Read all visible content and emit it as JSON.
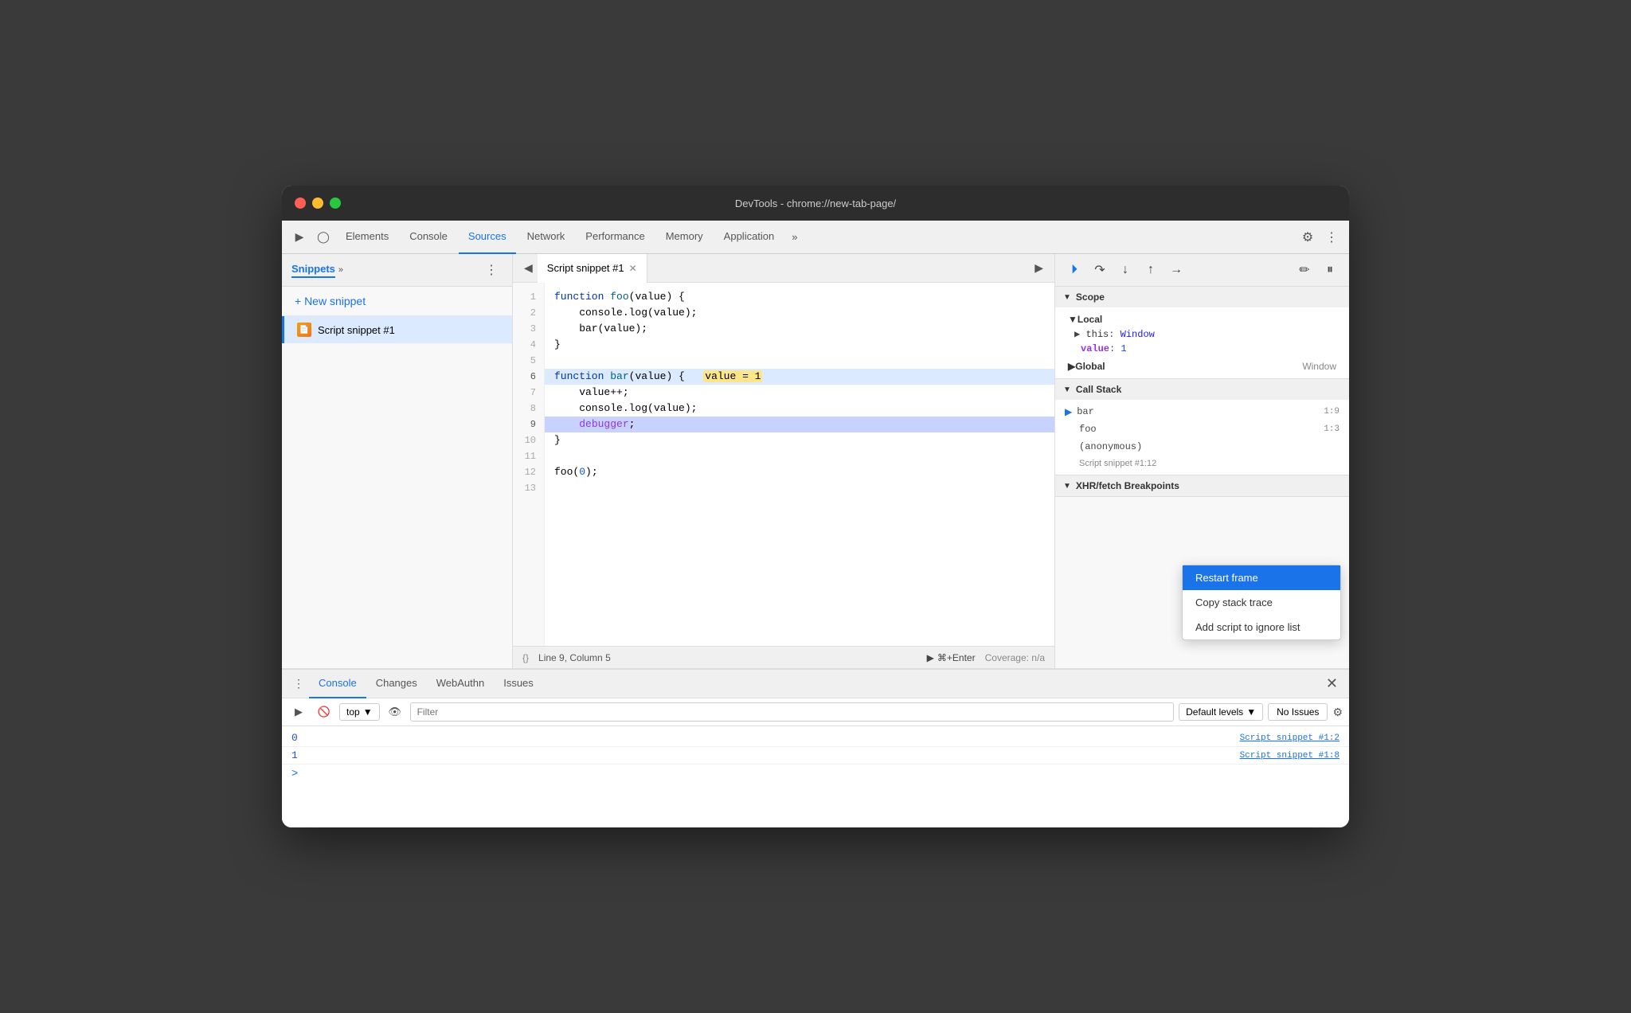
{
  "window": {
    "title": "DevTools - chrome://new-tab-page/"
  },
  "nav": {
    "tabs": [
      {
        "label": "Elements",
        "active": false
      },
      {
        "label": "Console",
        "active": false
      },
      {
        "label": "Sources",
        "active": true
      },
      {
        "label": "Network",
        "active": false
      },
      {
        "label": "Performance",
        "active": false
      },
      {
        "label": "Memory",
        "active": false
      },
      {
        "label": "Application",
        "active": false
      }
    ],
    "more_label": "»",
    "settings_title": "Settings",
    "dots_title": "More options"
  },
  "sidebar": {
    "tab_label": "Snippets",
    "new_snippet_label": "+ New snippet",
    "snippet_name": "Script snippet #1"
  },
  "editor": {
    "tab_name": "Script snippet #1",
    "lines": [
      {
        "num": 1,
        "code": "function foo(value) {"
      },
      {
        "num": 2,
        "code": "    console.log(value);"
      },
      {
        "num": 3,
        "code": "    bar(value);"
      },
      {
        "num": 4,
        "code": "}"
      },
      {
        "num": 5,
        "code": ""
      },
      {
        "num": 6,
        "code": "function bar(value) {   value = 1"
      },
      {
        "num": 7,
        "code": "    value++;"
      },
      {
        "num": 8,
        "code": "    console.log(value);"
      },
      {
        "num": 9,
        "code": "    debugger;",
        "paused": true
      },
      {
        "num": 10,
        "code": "}"
      },
      {
        "num": 11,
        "code": ""
      },
      {
        "num": 12,
        "code": "foo(0);"
      },
      {
        "num": 13,
        "code": ""
      }
    ],
    "status": {
      "format": "{}",
      "location": "Line 9, Column 5",
      "run_label": "⌘+Enter",
      "run_icon": "▶",
      "coverage": "Coverage: n/a"
    }
  },
  "right_panel": {
    "debugger_tools": [
      "resume",
      "step-over",
      "step-into",
      "step-out",
      "step",
      "deactivate",
      "pause"
    ],
    "scope_label": "Scope",
    "local_label": "Local",
    "this_label": "this:",
    "this_val": "Window",
    "value_label": "value:",
    "value_val": "1",
    "global_label": "Global",
    "global_val": "Window",
    "callstack_label": "Call Stack",
    "callstack_items": [
      {
        "name": "bar",
        "loc": "1:9"
      },
      {
        "name": "foo",
        "loc": "1:3"
      },
      {
        "name": "(anonymous)",
        "loc": ""
      }
    ],
    "snippet_loc": "Script snippet #1:12",
    "xhr_label": "XHR/fetch Breakpoints"
  },
  "context_menu": {
    "items": [
      {
        "label": "Restart frame",
        "selected": true
      },
      {
        "label": "Copy stack trace",
        "selected": false
      },
      {
        "label": "Add script to ignore list",
        "selected": false
      }
    ]
  },
  "console": {
    "tabs": [
      "Console",
      "Changes",
      "WebAuthn",
      "Issues"
    ],
    "active_tab": "Console",
    "toolbar": {
      "top_label": "top",
      "filter_placeholder": "Filter",
      "default_levels": "Default levels",
      "no_issues": "No Issues"
    },
    "logs": [
      {
        "val": "0",
        "src": "Script snippet #1:2"
      },
      {
        "val": "1",
        "src": "Script snippet #1:8"
      }
    ],
    "prompt": ">"
  }
}
